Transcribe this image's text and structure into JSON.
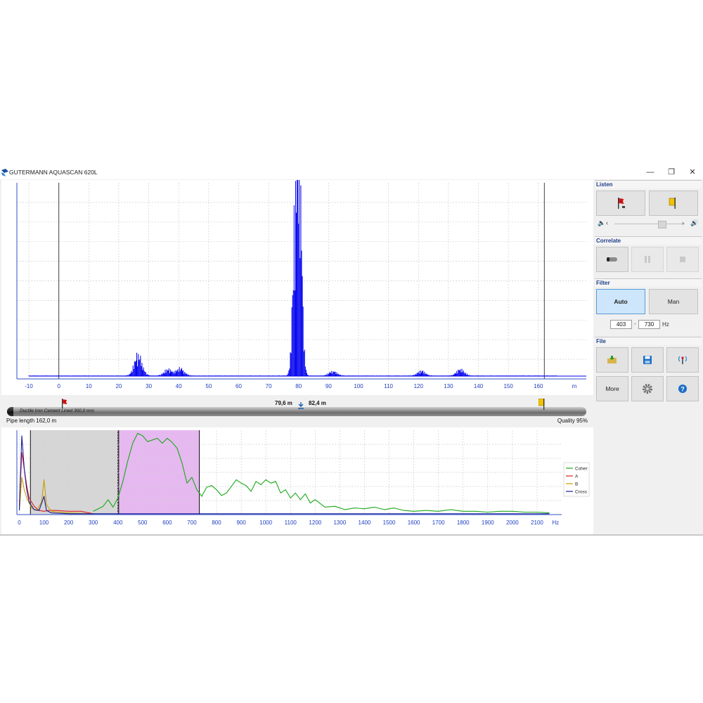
{
  "window": {
    "title": "GUTERMANN AQUASCAN 620L"
  },
  "colors": {
    "accent": "#1f3d8a",
    "signal": "#0000ee",
    "coher": "#1aa81a",
    "sensor_a": "#e02020",
    "sensor_b": "#c8a000",
    "cross": "#1a1a9a",
    "selection": "#e6b8f0"
  },
  "correlation": {
    "x_unit": "m",
    "x_ticks": [
      "-10",
      "0",
      "10",
      "20",
      "30",
      "40",
      "50",
      "60",
      "70",
      "80",
      "90",
      "100",
      "110",
      "120",
      "130",
      "140",
      "150",
      "160"
    ],
    "sensor_line_a": 0,
    "sensor_line_b": 162
  },
  "pipe": {
    "material": "Ductile Iron Cement Lined 300,0 mm",
    "dist_a": "79,6 m",
    "dist_b": "82,4 m",
    "length_label": "Pipe length 162,0 m",
    "quality_label": "Quality 95%",
    "sensor_b_label": "B"
  },
  "spectrum": {
    "x_unit": "Hz",
    "x_ticks": [
      "0",
      "100",
      "200",
      "300",
      "400",
      "500",
      "600",
      "700",
      "800",
      "900",
      "1000",
      "1100",
      "1200",
      "1300",
      "1400",
      "1500",
      "1600",
      "1700",
      "1800",
      "1900",
      "2000",
      "2100"
    ],
    "grey_band": [
      45,
      400
    ],
    "filter_band": [
      403,
      730
    ],
    "legend": [
      "Coher",
      "A",
      "B",
      "Cross"
    ]
  },
  "chart_data": [
    {
      "type": "bar",
      "x_unit": "m",
      "xlim": [
        -14,
        176
      ],
      "peaks": [
        {
          "center": 79.6,
          "height": 1.0
        },
        {
          "center": 80.6,
          "height": 0.85
        },
        {
          "center": 78.6,
          "height": 0.6
        },
        {
          "center": 26.5,
          "height": 0.14
        },
        {
          "center": 36.5,
          "height": 0.04
        },
        {
          "center": 40.5,
          "height": 0.05
        },
        {
          "center": 91.5,
          "height": 0.03
        },
        {
          "center": 121,
          "height": 0.03
        },
        {
          "center": 134,
          "height": 0.04
        }
      ]
    },
    {
      "type": "line",
      "x_unit": "Hz",
      "xlim": [
        -10,
        2200
      ],
      "series": [
        {
          "name": "Coher",
          "x": [
            300,
            340,
            360,
            380,
            400,
            420,
            440,
            460,
            480,
            500,
            520,
            540,
            560,
            580,
            600,
            620,
            640,
            660,
            680,
            700,
            720,
            740,
            760,
            780,
            800,
            820,
            840,
            860,
            880,
            900,
            920,
            940,
            960,
            980,
            1000,
            1020,
            1040,
            1060,
            1080,
            1100,
            1120,
            1140,
            1160,
            1180,
            1200,
            1240,
            1280,
            1320,
            1360,
            1400,
            1440,
            1480,
            1520,
            1560,
            1600,
            1650,
            1700,
            1750,
            1800,
            1850,
            1900,
            1950,
            2000,
            2050,
            2100,
            2150
          ],
          "y": [
            0.04,
            0.1,
            0.18,
            0.09,
            0.2,
            0.4,
            0.65,
            0.86,
            0.98,
            0.95,
            0.88,
            0.9,
            0.92,
            0.86,
            0.92,
            0.87,
            0.8,
            0.62,
            0.38,
            0.45,
            0.3,
            0.22,
            0.33,
            0.35,
            0.3,
            0.23,
            0.26,
            0.34,
            0.42,
            0.38,
            0.35,
            0.28,
            0.4,
            0.36,
            0.42,
            0.38,
            0.4,
            0.26,
            0.3,
            0.2,
            0.26,
            0.18,
            0.25,
            0.14,
            0.18,
            0.09,
            0.1,
            0.06,
            0.08,
            0.07,
            0.09,
            0.06,
            0.08,
            0.05,
            0.04,
            0.05,
            0.04,
            0.06,
            0.04,
            0.04,
            0.03,
            0.04,
            0.04,
            0.03,
            0.03,
            0.02
          ]
        },
        {
          "name": "A",
          "x": [
            0,
            10,
            20,
            30,
            40,
            60,
            80,
            100,
            120,
            150,
            200,
            250,
            300
          ],
          "y": [
            0.1,
            0.75,
            0.55,
            0.35,
            0.2,
            0.1,
            0.05,
            0.04,
            0.05,
            0.05,
            0.04,
            0.04,
            0.01
          ]
        },
        {
          "name": "B",
          "x": [
            0,
            10,
            20,
            30,
            50,
            70,
            90,
            100,
            110,
            130,
            160,
            200,
            300
          ],
          "y": [
            0.05,
            0.45,
            0.3,
            0.2,
            0.08,
            0.05,
            0.15,
            0.42,
            0.12,
            0.04,
            0.03,
            0.02,
            0.01
          ]
        },
        {
          "name": "Cross",
          "x": [
            0,
            10,
            15,
            20,
            30,
            40,
            60,
            80,
            100,
            110,
            130,
            200,
            300,
            2150
          ],
          "y": [
            0.05,
            0.95,
            0.75,
            0.55,
            0.3,
            0.15,
            0.06,
            0.05,
            0.22,
            0.05,
            0.02,
            0.01,
            0.01,
            0.01
          ]
        }
      ]
    }
  ],
  "side": {
    "listen": {
      "title": "Listen",
      "a_label": "A",
      "b_label": "B"
    },
    "correlate": {
      "title": "Correlate"
    },
    "filter": {
      "title": "Filter",
      "auto_label": "Auto",
      "man_label": "Man",
      "low": "403",
      "high": "730",
      "sep": "-",
      "unit": "Hz"
    },
    "file": {
      "title": "File",
      "more_label": "More"
    }
  }
}
